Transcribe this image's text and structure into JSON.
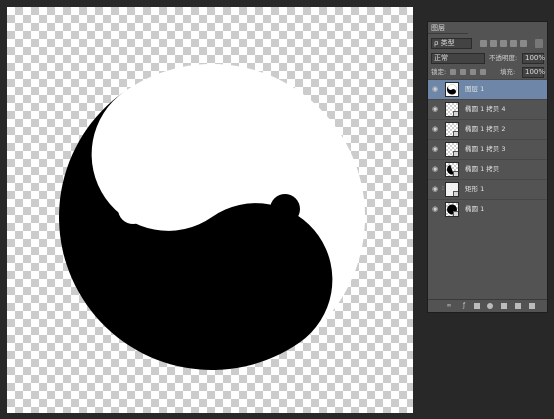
{
  "panel": {
    "tab_label": "图层",
    "filter_kind": "ρ 类型",
    "blend_mode": "正常",
    "opacity_label": "不透明度:",
    "opacity_value": "100%",
    "lock_label": "锁定:",
    "fill_label": "填充:",
    "fill_value": "100%"
  },
  "layers": [
    {
      "name": "图层 1",
      "selected": true,
      "thumb": "yinyang"
    },
    {
      "name": "椭圆 1 拷贝 4",
      "selected": false,
      "thumb": "transparent"
    },
    {
      "name": "椭圆 1 拷贝 2",
      "selected": false,
      "thumb": "transparent"
    },
    {
      "name": "椭圆 1 拷贝 3",
      "selected": false,
      "thumb": "transparent"
    },
    {
      "name": "椭圆 1 拷贝",
      "selected": false,
      "thumb": "half-circle"
    },
    {
      "name": "矩形 1",
      "selected": false,
      "thumb": "white-rect"
    },
    {
      "name": "椭圆 1",
      "selected": false,
      "thumb": "black-circle"
    }
  ],
  "footer_icons": [
    "link-icon",
    "fx-icon",
    "mask-icon",
    "adjustment-icon",
    "folder-icon",
    "new-layer-icon",
    "trash-icon"
  ],
  "colors": {
    "panel_bg": "#535353",
    "selection": "#6e87a8",
    "workspace": "#282828"
  }
}
